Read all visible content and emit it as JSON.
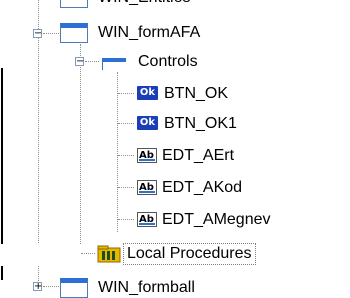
{
  "tree": {
    "top_partial_label": "WIN_Entitles",
    "form_afa_label": "WIN_formAFA",
    "controls_label": "Controls",
    "controls": [
      {
        "icon": "ok-button-icon",
        "label": "BTN_OK"
      },
      {
        "icon": "ok-button-icon",
        "label": "BTN_OK1"
      },
      {
        "icon": "edit-field-icon",
        "label": "EDT_AErt"
      },
      {
        "icon": "edit-field-icon",
        "label": "EDT_AKod"
      },
      {
        "icon": "edit-field-icon",
        "label": "EDT_AMegnev"
      }
    ],
    "local_procedures_label": "Local Procedures",
    "bottom_partial_label": "WIN_formball"
  },
  "icons": {
    "ok_text": "Ok",
    "ab_text": "Ab"
  },
  "colors": {
    "window_blue": "#2e6fd3",
    "ok_icon_bg": "#1a3db8",
    "tree_line": "#8f8f8f"
  }
}
